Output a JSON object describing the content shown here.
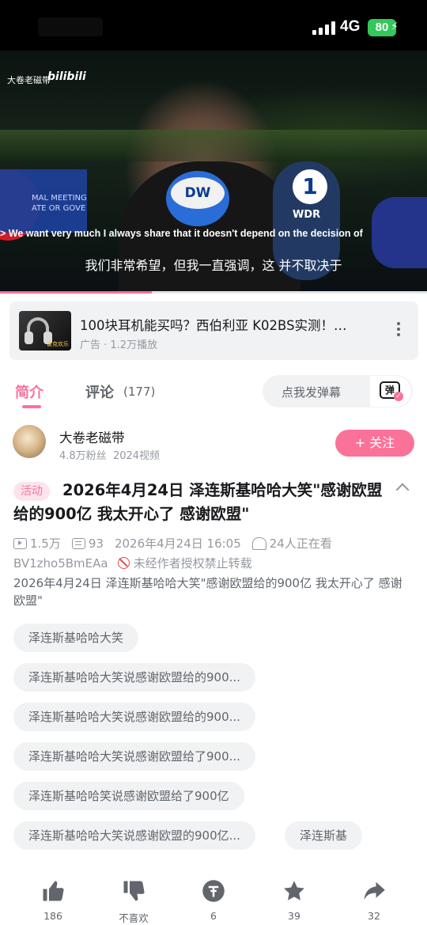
{
  "status_bar": {
    "network": "4G",
    "battery": "80"
  },
  "video": {
    "uploader_watermark": "大卷老磁带",
    "platform_watermark": "bilibili",
    "banner_text": "MAL MEETING\nATE OR GOVE",
    "mic_dw": "DW",
    "mic_ard": "1",
    "mic_wdr": "WDR",
    "subtitle_en": "> We want very much I always share that it doesn't depend on the decision of",
    "subtitle_zh": "我们非常希望，但我一直强调，这 并不取决于",
    "progress_fraction": 0.355
  },
  "ad": {
    "thumb_text": "雷克欢乐",
    "title": "100块耳机能买吗？西伯利亚 K02BS实测！…",
    "meta": "广告 · 1.2万播放"
  },
  "tabs": {
    "intro": "简介",
    "comments": "评论",
    "comments_count": "(177)"
  },
  "danmaku": {
    "placeholder": "点我发弹幕",
    "icon_char": "弹"
  },
  "uploader": {
    "name": "大卷老磁带",
    "fans": "4.8万粉丝",
    "videos": "2024视频",
    "follow_label": "+ 关注"
  },
  "video_info": {
    "tag": "活动",
    "title": "2026年4月24日 泽连斯基哈哈大笑\"感谢欧盟给的900亿 我太开心了 感谢欧盟\"",
    "views": "1.5万",
    "danmaku_count": "93",
    "publish_time": "2026年4月24日 16:05",
    "watching": "24人正在看",
    "bvid": "BV1zho5BmEAa",
    "copyright": "未经作者授权禁止转载",
    "description": "2026年4月24日 泽连斯基哈哈大笑\"感谢欧盟给的900亿 我太开心了 感谢欧盟\""
  },
  "tags": [
    "泽连斯基哈哈大笑",
    "泽连斯基哈哈大笑说感谢欧盟给的900...",
    "泽连斯基哈哈大笑说感谢欧盟给的900...",
    "泽连斯基哈哈大笑说感谢欧盟给了900...",
    "泽连斯基哈哈笑说感谢欧盟给了900亿",
    "泽连斯基哈哈大笑说感谢欧盟的900亿...",
    "泽连斯基"
  ],
  "actions": {
    "like": "186",
    "dislike": "不喜欢",
    "coin": "6",
    "favorite": "39",
    "share": "32"
  },
  "colors": {
    "accent": "#fb7299",
    "text": "#18191c",
    "muted": "#9499a0"
  }
}
